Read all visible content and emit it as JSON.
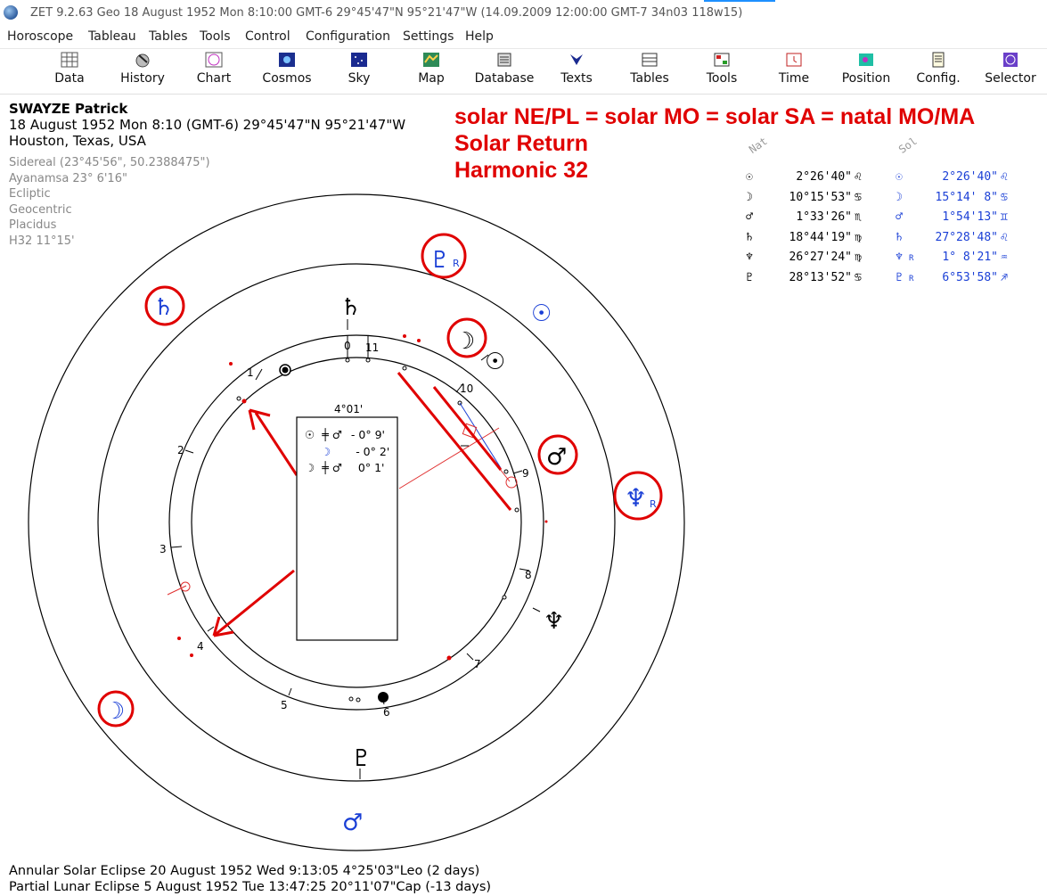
{
  "window": {
    "title": "ZET 9.2.63 Geo   18 August 1952  Mon   8:10:00 GMT-6 29°45'47\"N  95°21'47\"W  (14.09.2009  12:00:00 GMT-7 34n03 118w15)"
  },
  "menu": [
    "Horoscope",
    "Tableau",
    "Tables",
    "Tools",
    "Control",
    "Configuration",
    "Settings",
    "Help"
  ],
  "toolbar": [
    {
      "label": "Data",
      "icon": "grid-icon"
    },
    {
      "label": "History",
      "icon": "history-icon"
    },
    {
      "label": "Chart",
      "icon": "chart-icon"
    },
    {
      "label": "Cosmos",
      "icon": "cosmos-icon"
    },
    {
      "label": "Sky",
      "icon": "sky-icon"
    },
    {
      "label": "Map",
      "icon": "map-icon"
    },
    {
      "label": "Database",
      "icon": "database-icon"
    },
    {
      "label": "Texts",
      "icon": "texts-icon"
    },
    {
      "label": "Tables",
      "icon": "tables-icon"
    },
    {
      "label": "Tools",
      "icon": "tools-icon"
    },
    {
      "label": "Time",
      "icon": "time-icon"
    },
    {
      "label": "Position",
      "icon": "position-icon"
    },
    {
      "label": "Config.",
      "icon": "config-icon"
    },
    {
      "label": "Selector",
      "icon": "selector-icon"
    }
  ],
  "info": {
    "name": "SWAYZE Patrick",
    "date_line": "18 August 1952  Mon   8:10 (GMT-6) 29°45'47\"N  95°21'47\"W",
    "place": "Houston, Texas, USA"
  },
  "settings": [
    "Sidereal (23°45'56\", 50.2388475\")",
    "Ayanamsa 23° 6'16\"",
    "Ecliptic",
    "Geocentric",
    "Placidus",
    "H32  11°15'"
  ],
  "annotation": [
    "solar NE/PL = solar MO = solar SA = natal MO/MA",
    "Solar Return",
    "Harmonic 32"
  ],
  "positions": {
    "natal_header": "Nat",
    "solar_header": "Sol",
    "natal": [
      {
        "sym": "☉",
        "val": "2°26'40\"",
        "sign": "♌"
      },
      {
        "sym": "☽",
        "val": "10°15'53\"",
        "sign": "♋"
      },
      {
        "sym": "♂",
        "val": "1°33'26\"",
        "sign": "♏"
      },
      {
        "sym": "♄",
        "val": "18°44'19\"",
        "sign": "♍"
      },
      {
        "sym": "♆",
        "val": "26°27'24\"",
        "sign": "♍"
      },
      {
        "sym": "♇",
        "val": "28°13'52\"",
        "sign": "♋"
      }
    ],
    "solar": [
      {
        "sym": "☉",
        "val": "2°26'40\"",
        "sign": "♌",
        "retro": ""
      },
      {
        "sym": "☽",
        "val": "15°14' 8\"",
        "sign": "♋",
        "retro": ""
      },
      {
        "sym": "♂",
        "val": "1°54'13\"",
        "sign": "♊",
        "retro": ""
      },
      {
        "sym": "♄",
        "val": "27°28'48\"",
        "sign": "♌",
        "retro": ""
      },
      {
        "sym": "♆",
        "val": "1° 8'21\"",
        "sign": "♒",
        "retro": "R"
      },
      {
        "sym": "♇",
        "val": "6°53'58\"",
        "sign": "♐",
        "retro": "R"
      }
    ]
  },
  "aspect_box": {
    "header": "4°01'",
    "rows": [
      {
        "a": "☉",
        "b": "♂",
        "val": "- 0° 9'"
      },
      {
        "a": "☽",
        "b": "",
        "val": "- 0° 2'"
      },
      {
        "a": "☽",
        "b": "♂",
        "val": "0° 1'"
      }
    ]
  },
  "wheel": {
    "houses": [
      "1",
      "2",
      "3",
      "4",
      "5",
      "6",
      "7",
      "8",
      "9",
      "10",
      "11",
      "0"
    ],
    "inner_glyphs": {
      "saturn": "♄",
      "sun": "☉",
      "neptune": "♆",
      "pluto": "♇"
    },
    "outer_glyphs": {
      "pluto": "♇",
      "saturn": "♄",
      "sun": "☉",
      "moon": "☽",
      "mars": "♂",
      "neptune": "♆",
      "moon_bottom": "☽",
      "mars_bottom": "♂"
    },
    "retro": "R",
    "colors": {
      "natal": "#000000",
      "solar": "#1a3fd6",
      "highlight": "#e00000",
      "aspect": "#e03030"
    }
  },
  "footer": [
    "Annular Solar Eclipse 20 August 1952 Wed  9:13:05  4°25'03\"Leo (2 days)",
    "Partial Lunar Eclipse 5 August 1952 Tue 13:47:25 20°11'07\"Cap (-13 days)"
  ]
}
